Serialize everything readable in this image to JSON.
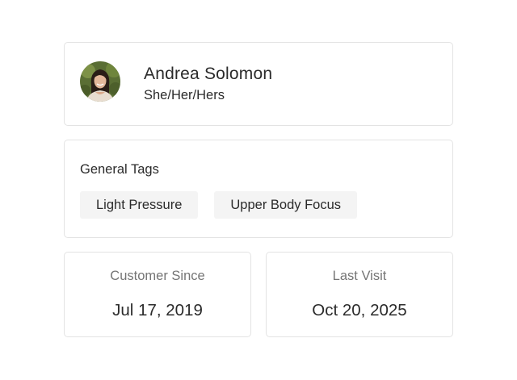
{
  "profile": {
    "name": "Andrea Solomon",
    "pronouns": "She/Her/Hers"
  },
  "tags": {
    "title": "General Tags",
    "items": [
      "Light Pressure",
      "Upper Body Focus"
    ]
  },
  "stats": {
    "customer_since": {
      "label": "Customer Since",
      "value": "Jul 17, 2019"
    },
    "last_visit": {
      "label": "Last Visit",
      "value": "Oct 20, 2025"
    }
  },
  "colors": {
    "border": "#e3e3e3",
    "tag_background": "#f4f4f4",
    "muted_text": "#757575",
    "text": "#2b2b2b"
  }
}
